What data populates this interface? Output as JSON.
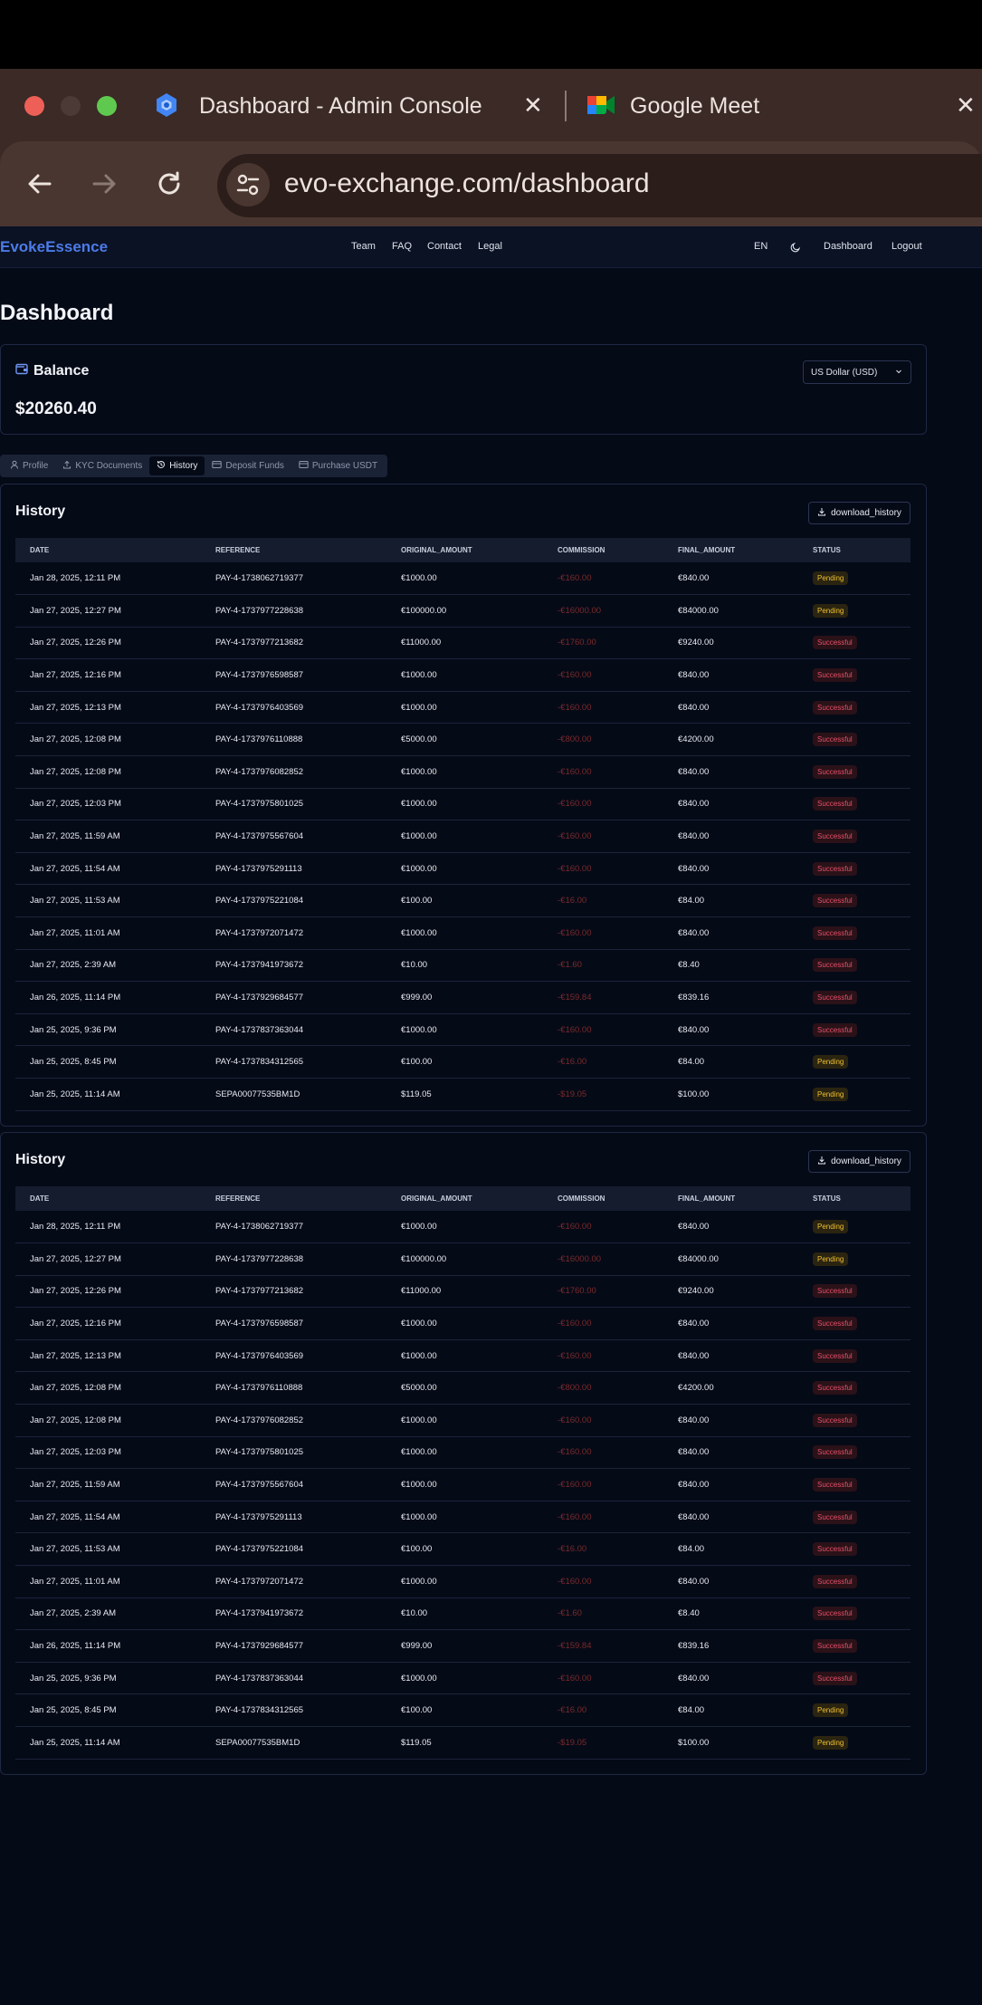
{
  "browser": {
    "tabs": [
      {
        "title": "Dashboard - Admin Console"
      },
      {
        "title": "Google Meet"
      }
    ],
    "url": "evo-exchange.com/dashboard"
  },
  "nav": {
    "brand": "EvokeEssence",
    "links": [
      "Team",
      "FAQ",
      "Contact",
      "Legal"
    ],
    "lang": "EN",
    "dashboard": "Dashboard",
    "logout": "Logout"
  },
  "page": {
    "title": "Dashboard"
  },
  "balance": {
    "title": "Balance",
    "amount": "$20260.40",
    "currency": "US Dollar (USD)"
  },
  "tabs": [
    "Profile",
    "KYC Documents",
    "History",
    "Deposit Funds",
    "Purchase USDT"
  ],
  "active_tab": "History",
  "history": {
    "title": "History",
    "download_label": "download_history",
    "columns": [
      "DATE",
      "REFERENCE",
      "ORIGINAL_AMOUNT",
      "COMMISSION",
      "FINAL_AMOUNT",
      "STATUS"
    ],
    "rows": [
      [
        "Jan 28, 2025, 12:11 PM",
        "PAY-4-1738062719377",
        "€1000.00",
        "-€160.00",
        "€840.00",
        "Pending"
      ],
      [
        "Jan 27, 2025, 12:27 PM",
        "PAY-4-1737977228638",
        "€100000.00",
        "-€16000.00",
        "€84000.00",
        "Pending"
      ],
      [
        "Jan 27, 2025, 12:26 PM",
        "PAY-4-1737977213682",
        "€11000.00",
        "-€1760.00",
        "€9240.00",
        "Successful"
      ],
      [
        "Jan 27, 2025, 12:16 PM",
        "PAY-4-1737976598587",
        "€1000.00",
        "-€160.00",
        "€840.00",
        "Successful"
      ],
      [
        "Jan 27, 2025, 12:13 PM",
        "PAY-4-1737976403569",
        "€1000.00",
        "-€160.00",
        "€840.00",
        "Successful"
      ],
      [
        "Jan 27, 2025, 12:08 PM",
        "PAY-4-1737976110888",
        "€5000.00",
        "-€800.00",
        "€4200.00",
        "Successful"
      ],
      [
        "Jan 27, 2025, 12:08 PM",
        "PAY-4-1737976082852",
        "€1000.00",
        "-€160.00",
        "€840.00",
        "Successful"
      ],
      [
        "Jan 27, 2025, 12:03 PM",
        "PAY-4-1737975801025",
        "€1000.00",
        "-€160.00",
        "€840.00",
        "Successful"
      ],
      [
        "Jan 27, 2025, 11:59 AM",
        "PAY-4-1737975567604",
        "€1000.00",
        "-€160.00",
        "€840.00",
        "Successful"
      ],
      [
        "Jan 27, 2025, 11:54 AM",
        "PAY-4-1737975291113",
        "€1000.00",
        "-€160.00",
        "€840.00",
        "Successful"
      ],
      [
        "Jan 27, 2025, 11:53 AM",
        "PAY-4-1737975221084",
        "€100.00",
        "-€16.00",
        "€84.00",
        "Successful"
      ],
      [
        "Jan 27, 2025, 11:01 AM",
        "PAY-4-1737972071472",
        "€1000.00",
        "-€160.00",
        "€840.00",
        "Successful"
      ],
      [
        "Jan 27, 2025, 2:39 AM",
        "PAY-4-1737941973672",
        "€10.00",
        "-€1.60",
        "€8.40",
        "Successful"
      ],
      [
        "Jan 26, 2025, 11:14 PM",
        "PAY-4-1737929684577",
        "€999.00",
        "-€159.84",
        "€839.16",
        "Successful"
      ],
      [
        "Jan 25, 2025, 9:36 PM",
        "PAY-4-1737837363044",
        "€1000.00",
        "-€160.00",
        "€840.00",
        "Successful"
      ],
      [
        "Jan 25, 2025, 8:45 PM",
        "PAY-4-1737834312565",
        "€100.00",
        "-€16.00",
        "€84.00",
        "Pending"
      ],
      [
        "Jan 25, 2025, 11:14 AM",
        "SEPA00077535BM1D",
        "$119.05",
        "-$19.05",
        "$100.00",
        "Pending"
      ]
    ]
  },
  "colors": {
    "accent": "#4c7be8",
    "pending": "#f0c030",
    "successful": "#e8506a",
    "commission": "#7a2a2a"
  }
}
